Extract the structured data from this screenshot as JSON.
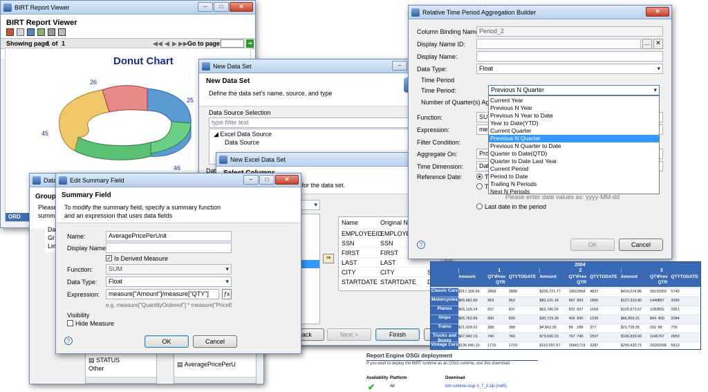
{
  "birt": {
    "title": "BIRT Report Viewer",
    "header": "BIRT Report Viewer",
    "showing": "Showing page",
    "page_current": "1",
    "of": "of",
    "page_total": "1",
    "goto_label": "Go to page:",
    "chart_title": "Donut Chart",
    "labels": [
      "26",
      "25",
      "45",
      "46"
    ],
    "footer": "ORD"
  },
  "newds": {
    "title": "New Data Set",
    "heading": "New Data Set",
    "desc": "Define the data set's name, source, and type",
    "section": "Data Source Selection",
    "filter_placeholder": "type filter text",
    "tree_parent": "Excel Data Source",
    "tree_child": "Data Source",
    "data_partial": "Data",
    "back": "< Back",
    "next": "Next >",
    "finish": "Finish"
  },
  "excel": {
    "title": "New Excel Data Set",
    "heading": "Select Columns",
    "desc": "heet and columns for the data set.",
    "sheet": "Employee",
    "col_name": "Name",
    "col_orig": "Original Na",
    "rows": [
      {
        "name": "EMPLOYEEID",
        "orig": "EMPLOYEE",
        "t": ""
      },
      {
        "name": "SSN",
        "orig": "SSN",
        "t": ""
      },
      {
        "name": "FIRST",
        "orig": "FIRST",
        "t": ""
      },
      {
        "name": "LAST",
        "orig": "LAST",
        "t": ""
      },
      {
        "name": "CITY",
        "orig": "CITY",
        "t": "Strin"
      },
      {
        "name": "STARTDATE",
        "orig": "STARTDATE",
        "t": "Date"
      }
    ],
    "left_items": [
      "Y",
      "TE"
    ]
  },
  "group": {
    "title": "Data",
    "heading": "Group",
    "please": "Please",
    "summ": "summ",
    "items": [
      "Da",
      "Gr",
      "Lin"
    ],
    "status": "STATUS",
    "other": "Other",
    "right_item": "AveragePricePerU"
  },
  "summary": {
    "title": "Edit Summary Field",
    "heading": "Summary Field",
    "desc1": "To modify the summary field, specify a summary function",
    "desc2": "and an expression that uses data fields",
    "name_label": "Name:",
    "name_value": "AveragePricePerUnit",
    "display_label": "Display Name:",
    "derived_label": "Is Derived Measure",
    "function_label": "Function:",
    "function_value": "SUM",
    "datatype_label": "Data Type:",
    "datatype_value": "Float",
    "expression_label": "Expression:",
    "expression_value": "measure[\"Amount\"]/measure[\"QTY\"]",
    "expression_hint": "e.g. measure[\"QuantityOrdered\"] * measure[\"PriceE",
    "visibility": "Visibility",
    "hide_label": "Hide Measure",
    "ok": "OK",
    "cancel": "Cancel"
  },
  "rtp": {
    "title": "Relative Time Period Aggregation Builder",
    "colbind_label": "Column Binding Name:",
    "colbind_value": "Period_2",
    "dnid_label": "Display Name ID:",
    "dn_label": "Display Name:",
    "dtype_label": "Data Type:",
    "dtype_value": "Float",
    "time_period_group": "Time Period",
    "time_period_label": "Time Period:",
    "time_period_value": "Previous N Quarter",
    "numq_label": "Number of Quarter(s) Ago:",
    "function_label": "Function:",
    "function_value": "SUM",
    "expression_label": "Expression:",
    "expression_value": "me",
    "filter_label": "Filter Condition:",
    "aggregate_label": "Aggregate On:",
    "aggregate_value": "Prod",
    "timedim_label": "Time Dimension:",
    "timedim_value": "Date",
    "refdate_label": "Reference Date:",
    "ref_opt1": "To",
    "ref_opt2": "Th",
    "date_hint": "Please enter date values as: yyyy-MM-dd",
    "last_date": "Last date in the period",
    "ok": "OK",
    "cancel": "Cancel",
    "options": [
      "Current Year",
      "Previous N Year",
      "Previous N Year to Date",
      "Year to Date(YTD)",
      "Current Quarter",
      "Previous N Quarter",
      "Previous N Quarter to Date",
      "Quarter to Date(QTD)",
      "Quarter to Date Last Year",
      "Current Period",
      "Period to Date",
      "Trailing N Periods",
      "Next N Periods"
    ],
    "selected_index": 5
  },
  "crosstab": {
    "year": "2004",
    "quarters": [
      "1",
      "2",
      "3"
    ],
    "subheads": [
      "Amount",
      "QTY",
      "Prev QTR",
      "QTYTODATE"
    ],
    "rows": [
      {
        "label": "Classic Cars",
        "vals": [
          "$217,306.69",
          "2868",
          "",
          "2868",
          "$206,721.77",
          "1959",
          "2868",
          "4827",
          "$419,674.86",
          "3913",
          "1959",
          "5740"
        ]
      },
      {
        "label": "Motorcycles",
        "vals": [
          "$65,681.60",
          "953",
          "",
          "953",
          "$80,101.18",
          "897",
          "953",
          "1850",
          "$127,310.80",
          "1440",
          "897",
          "3290"
        ]
      },
      {
        "label": "Planes",
        "vals": [
          "$65,109.24",
          "837",
          "",
          "837",
          "$69,780.26",
          "832",
          "837",
          "1669",
          "$105,573.57",
          "1282",
          "832",
          "2951"
        ]
      },
      {
        "label": "Ships",
        "vals": [
          "$65,762.89",
          "830",
          "",
          "830",
          "$30,719.39",
          "400",
          "830",
          "1230",
          "$66,859.21",
          "864",
          "400",
          "2094"
        ]
      },
      {
        "label": "Trains",
        "vals": [
          "$21,028.52",
          "288",
          "",
          "288",
          "$4,862.35",
          "89",
          "288",
          "377",
          "$21,728.35",
          "332",
          "89",
          "709"
        ]
      },
      {
        "label": "Trucks and Buses",
        "vals": [
          "$67,942.19",
          "740",
          "",
          "740",
          "$73,696.23",
          "767",
          "740",
          "1507",
          "$106,833.60",
          "1146",
          "767",
          "2653"
        ]
      },
      {
        "label": "Vintage Cars",
        "vals": [
          "$136,840.15",
          "1719",
          "",
          "1719",
          "$110,997.67",
          "1568",
          "1719",
          "3287",
          "$200,420.71",
          "2525",
          "1568",
          "5812"
        ]
      }
    ]
  },
  "osgi": {
    "heading": "Report Engine OSGi deployment",
    "desc": "If you wish to deploy the BIRT runtime as an OSGi runtime, use this download.",
    "col_avail": "Availability",
    "col_platform": "Platform",
    "col_download": "Download",
    "platform": "All",
    "link": "birt-runtime-osgi-3_7_2.zip",
    "md5": "(md5)"
  }
}
